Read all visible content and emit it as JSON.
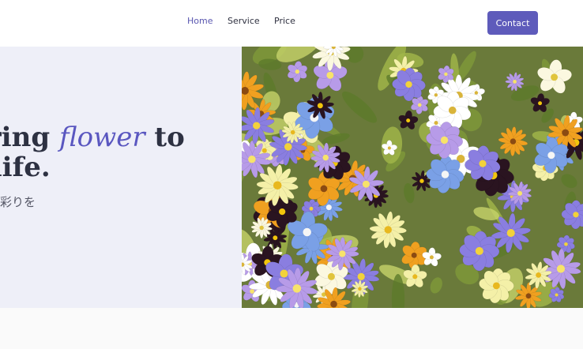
{
  "nav": {
    "home": "Home",
    "service": "Service",
    "price": "Price",
    "contact": "Contact"
  },
  "hero": {
    "title_line1_prefix": "bring",
    "title_accent": "flower",
    "title_line1_suffix": "to",
    "title_line2": "r life.",
    "subtitle": "活に彩りを"
  },
  "colors": {
    "accent": "#5e5bbb",
    "hero_bg": "#eeeff8"
  }
}
